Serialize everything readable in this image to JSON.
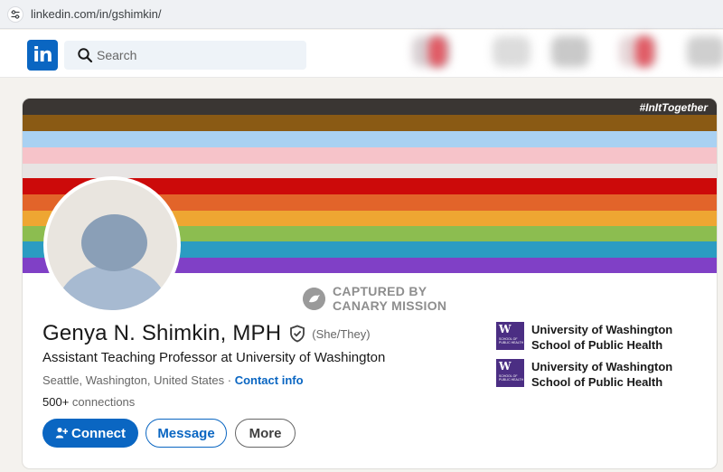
{
  "browser": {
    "url": "linkedin.com/in/gshimkin/",
    "icon": "site-settings-icon"
  },
  "nav": {
    "logo_text": "in",
    "search_placeholder": "Search",
    "accent": "#0a66c2"
  },
  "banner": {
    "hashtag": "#InItTogether",
    "stripe_colors": [
      "#3a3633",
      "#8a5a14",
      "#a9d1f2",
      "#f6c3c9",
      "#e7e4e3",
      "#cc0a0a",
      "#e2642a",
      "#eea632",
      "#8cbd50",
      "#2b9cc2",
      "#8040c6"
    ]
  },
  "watermark": {
    "line1": "CAPTURED BY",
    "line2": "CANARY MISSION"
  },
  "profile": {
    "name": "Genya N. Shimkin, MPH",
    "pronouns": "(She/They)",
    "headline": "Assistant Teaching Professor at University of Washington",
    "location": "Seattle, Washington, United States",
    "separator": " · ",
    "contact_info": "Contact info",
    "connections_count": "500+",
    "connections_label": " connections"
  },
  "actions": {
    "connect": "Connect",
    "message": "Message",
    "more": "More"
  },
  "organizations": [
    {
      "line1": "University of Washington",
      "line2": "School of Public Health",
      "logo_letter": "W",
      "logo_caption": "SCHOOL OF PUBLIC HEALTH"
    },
    {
      "line1": "University of Washington",
      "line2": "School of Public Health",
      "logo_letter": "W",
      "logo_caption": "SCHOOL OF PUBLIC HEALTH"
    }
  ]
}
